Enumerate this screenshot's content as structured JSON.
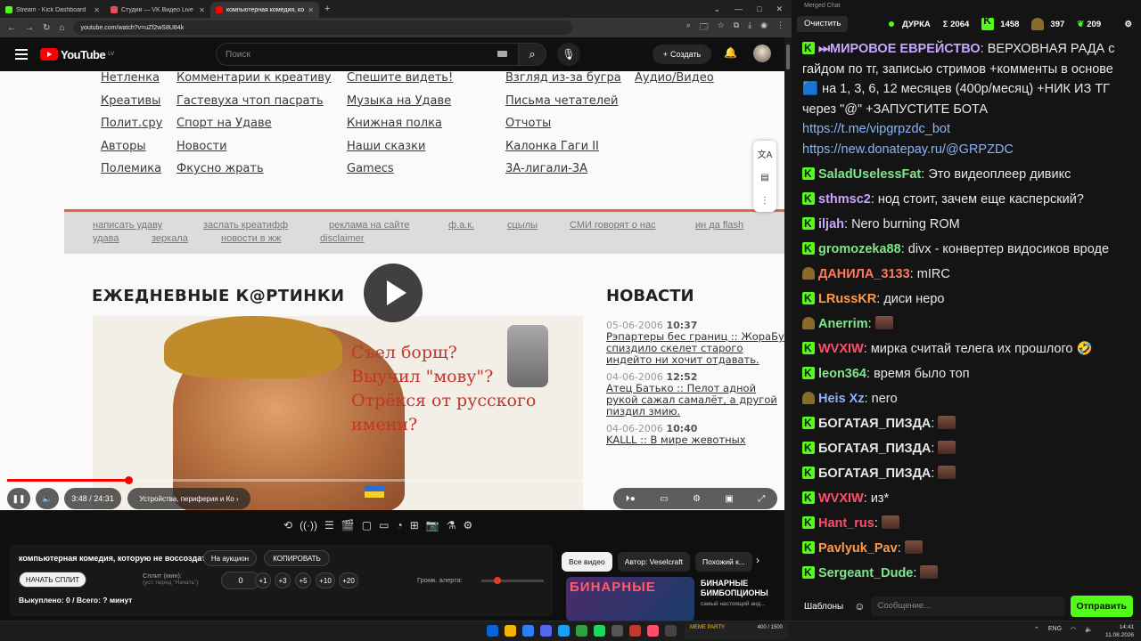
{
  "browser": {
    "tabs": [
      {
        "title": "Stream - Kick Dashboard",
        "color": "#53fc18"
      },
      {
        "title": "Студия — VK Видео Live",
        "color": "#e74c62"
      },
      {
        "title": "компьютерная комедия, кото...",
        "color": "#ff0000",
        "active": true
      }
    ],
    "url": "youtube.com/watch?v=uZf2wS8U84k"
  },
  "youtube": {
    "logo_text": "YouTube",
    "logo_region": "LV",
    "search_placeholder": "Поиск",
    "create_label": "Создать"
  },
  "video": {
    "site_nav": [
      [
        "Нетленка",
        "Комментарии к креативу",
        "Спешите видеть!",
        "Взгляд из-за бугра",
        "Аудио/Видео"
      ],
      [
        "Креативы",
        "Гастевуха чтоп пасрать",
        "Музыка на Удаве",
        "Письма четателей"
      ],
      [
        "Полит.сру",
        "Спорт на Удаве",
        "Книжная полка",
        "Отчоты"
      ],
      [
        "Авторы",
        "Новости",
        "Наши сказки",
        "Калонка Гаги II"
      ],
      [
        "Полемика",
        "Фкусно жрать",
        "Gamecs",
        "3А-лигали-3А"
      ]
    ],
    "bar_links_row1": [
      "написать удаву",
      "заслать креатифф",
      "реклама на сайте",
      "ф.а.к.",
      "сцылы",
      "СМИ говорят о нас",
      "ин да flash"
    ],
    "bar_links_row2": [
      "удава",
      "зеркала",
      "новости в жж",
      "disclaimer"
    ],
    "section_title": "ЕЖЕДНЕВНЫЕ К@РТИНКИ",
    "news_title": "НОВАСТИ",
    "poster_lines": [
      "Съел борщ?",
      "Выучил \"мову\"?",
      "Отрёкся от русского имени?"
    ],
    "news": [
      {
        "date": "05-06-2006",
        "time": "10:37",
        "text": "Рэпартеры бес границ :: ЖораБу спиздило скелет старого индейто ни хочит отдавать."
      },
      {
        "date": "04-06-2006",
        "time": "12:52",
        "text": "Атец Батько :: Пелот адной рукой сажал самалёт, а другой пиздил змию."
      },
      {
        "date": "04-06-2006",
        "time": "10:40",
        "text": "KALLL :: В мире жевотных"
      }
    ],
    "time_current": "3:48",
    "time_total": "24:31",
    "chapter": "Устройства, периферия и Ко",
    "progress": 0.157
  },
  "panel": {
    "title": "компьютерная комедия, которую не воссоздать",
    "auction_label": "На аукцион",
    "copy_label": "КОПИРОВАТЬ",
    "start_split_label": "НАЧАТЬ СПЛИТ",
    "split_label": "Сплит (мин):",
    "split_hint": "(уст. перед \"Начать\")",
    "split_value": "0",
    "increments": [
      "+1",
      "+3",
      "+5",
      "+10",
      "+20"
    ],
    "alert_volume_label": "Громк. алерта:",
    "alert_volume": 0.2,
    "stats": "Выкуплено: 0 / Всего: ? минут"
  },
  "related": {
    "tabs": [
      "Все видео",
      "Автор: Veselcraft",
      "Похожий к..."
    ],
    "video_title": "БИНАРНЫЕ БИМБОПЦИОНЫ",
    "video_sub": "самый настоящий анд...",
    "thumb_label": "БИНАРНЫЕ"
  },
  "chat": {
    "window_title": "Merged Chat",
    "clear_label": "Очистить",
    "streamer": "ДУРКА",
    "counts": [
      "Σ 2064",
      "1458",
      "397",
      "209"
    ],
    "messages": [
      {
        "nick": "⏭МИРОВОЕ ЕВРЕЙСТВО",
        "color": "#c9a6ff",
        "badge": "kick",
        "text": "ВЕРХОВНАЯ РАДА с гайдом по тг, записью стримов +комменты в основе 🟦 на 1, 3, 6, 12 месяцев (400р/месяц) +НИК ИЗ ТГ через \"@\" +ЗАПУСТИТЕ БОТА",
        "links": [
          "https://t.me/vipgrpzdc_bot",
          "https://new.donatepay.ru/@GRPZDC"
        ]
      },
      {
        "nick": "SaladUselessFat",
        "color": "#7ee787",
        "badge": "kick",
        "text": "Это видеоплеер дивикс"
      },
      {
        "nick": "sthmsc2",
        "color": "#c9a6ff",
        "badge": "kick",
        "text": "нод стоит, зачем еще касперский?"
      },
      {
        "nick": "iljah",
        "color": "#c9a6ff",
        "badge": "kick",
        "text": "Nero burning ROM"
      },
      {
        "nick": "gromozeka88",
        "color": "#7ee787",
        "badge": "kick",
        "text": "divx - конвертер видосиков вроде"
      },
      {
        "nick": "ДАНИЛА_3133",
        "color": "#ff7a5c",
        "badge": "hat",
        "text": "mIRC"
      },
      {
        "nick": "LRussKR",
        "color": "#ff9a4a",
        "badge": "kick",
        "text": "диси неро"
      },
      {
        "nick": "Anerrim",
        "color": "#7ee787",
        "badge": "hat",
        "text": ""
      },
      {
        "nick": "WVXIW",
        "color": "#ff4d6d",
        "badge": "kick",
        "text": "мирка считай телега их прошлого 🤣"
      },
      {
        "nick": "leon364",
        "color": "#7ee787",
        "badge": "kick",
        "text": "время было топ"
      },
      {
        "nick": "Heis Xz",
        "color": "#8ab4f8",
        "badge": "hat",
        "text": "nero"
      },
      {
        "nick": "БОГАТАЯ_ПИЗДА",
        "color": "#e8e8e8",
        "badge": "kick",
        "text": ""
      },
      {
        "nick": "БОГАТАЯ_ПИЗДА",
        "color": "#e8e8e8",
        "badge": "kick",
        "text": ""
      },
      {
        "nick": "БОГАТАЯ_ПИЗДА",
        "color": "#e8e8e8",
        "badge": "kick",
        "text": ""
      },
      {
        "nick": "WVXIW",
        "color": "#ff4d6d",
        "badge": "kick",
        "text": "из*"
      },
      {
        "nick": "Hant_rus",
        "color": "#ff4d6d",
        "badge": "kick",
        "text": ""
      },
      {
        "nick": "Pavlyuk_Pav",
        "color": "#ff9a4a",
        "badge": "kick",
        "text": ""
      },
      {
        "nick": "Sergeant_Dude",
        "color": "#7ee787",
        "badge": "kick",
        "text": ""
      }
    ],
    "templates_label": "Шаблоны",
    "input_placeholder": "Сообщение...",
    "send_label": "Отправить"
  },
  "taskbar": {
    "widget_text": "МЕМЕ PARTY",
    "widget_counter": "400 / 1500",
    "lang": "ENG",
    "time": "14:41",
    "date": "11.08.2026"
  }
}
